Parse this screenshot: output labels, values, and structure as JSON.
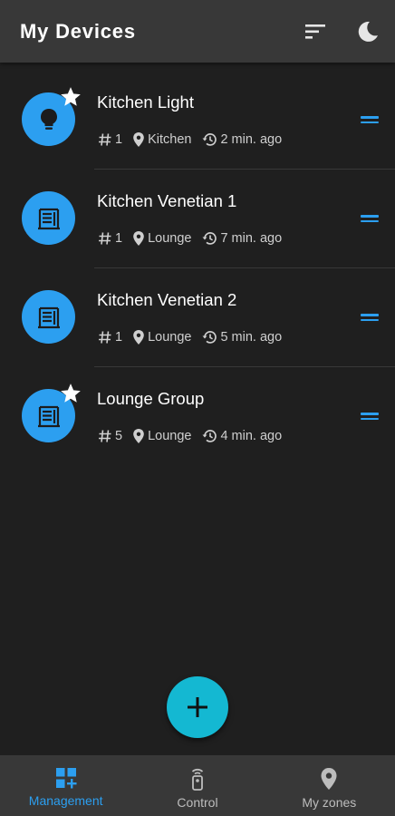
{
  "header": {
    "title": "My Devices",
    "sort_icon": "sort-icon",
    "theme_icon": "dark-mode-moon-icon"
  },
  "devices": [
    {
      "name": "Kitchen Light",
      "type_icon": "lightbulb-icon",
      "favorite": true,
      "id_text": "1",
      "zone": "Kitchen",
      "last_seen": "2 min. ago"
    },
    {
      "name": "Kitchen Venetian 1",
      "type_icon": "venetian-blind-icon",
      "favorite": false,
      "id_text": "1",
      "zone": "Lounge",
      "last_seen": "7 min. ago"
    },
    {
      "name": "Kitchen Venetian 2",
      "type_icon": "venetian-blind-icon",
      "favorite": false,
      "id_text": "1",
      "zone": "Lounge",
      "last_seen": "5 min. ago"
    },
    {
      "name": "Lounge Group",
      "type_icon": "venetian-blind-icon",
      "favorite": true,
      "id_text": "5",
      "zone": "Lounge",
      "last_seen": "4 min. ago"
    }
  ],
  "fab": {
    "icon": "plus-icon"
  },
  "bottom_nav": {
    "items": [
      {
        "label": "Management",
        "icon": "dashboard-add-icon",
        "active": true
      },
      {
        "label": "Control",
        "icon": "remote-control-icon",
        "active": false
      },
      {
        "label": "My zones",
        "icon": "location-pin-icon",
        "active": false
      }
    ]
  },
  "colors": {
    "accent": "#2c9ff0",
    "fab": "#14b8d2",
    "background": "#1f1f1f",
    "bars": "#383838"
  }
}
